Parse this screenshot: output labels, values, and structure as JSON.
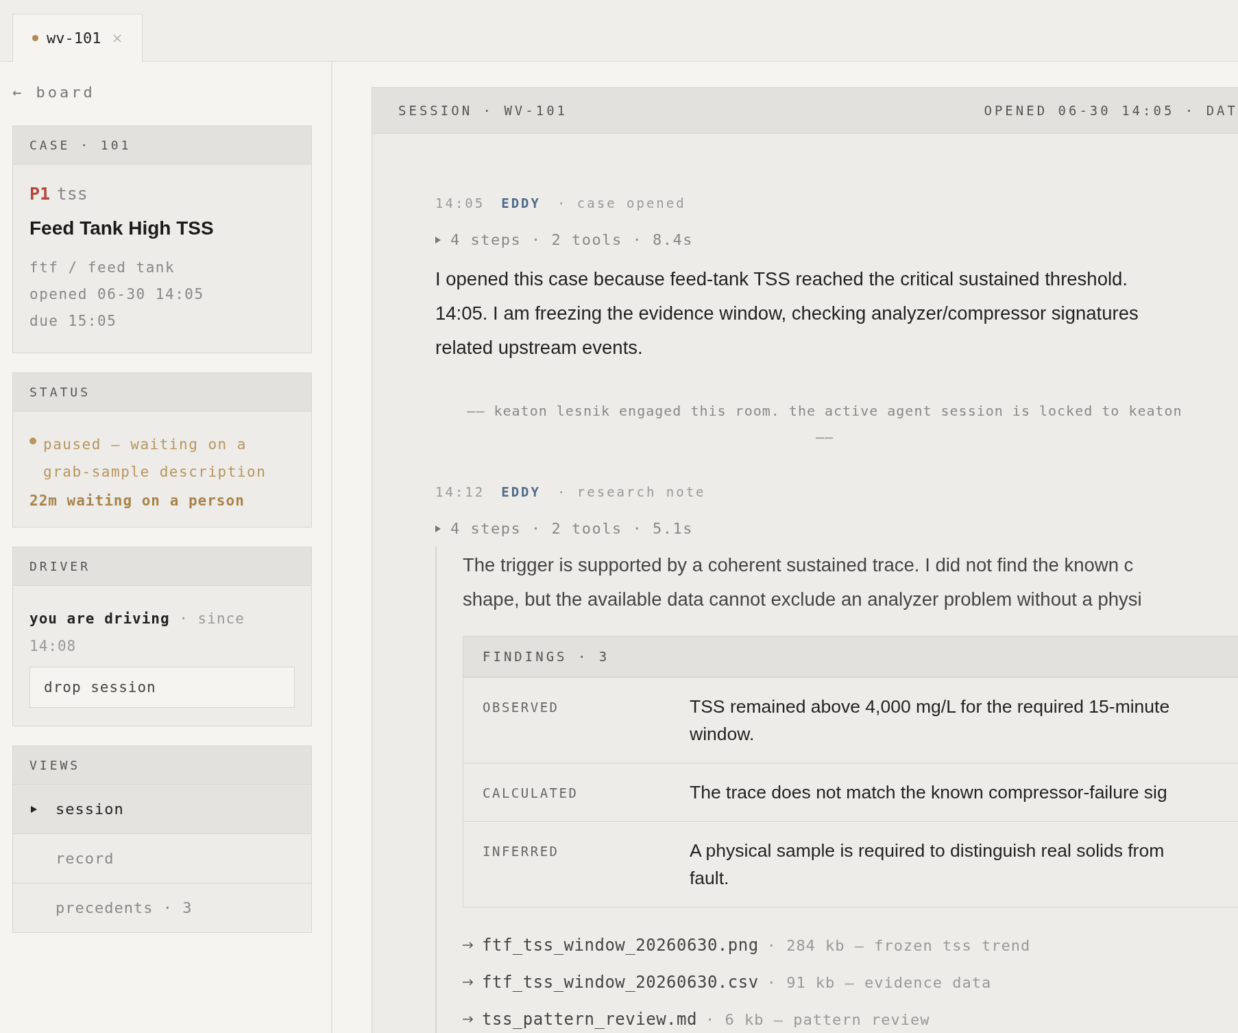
{
  "tabs": [
    {
      "label": "wv-101",
      "selected": true
    }
  ],
  "back_link": "← board",
  "case": {
    "header": "CASE · 101",
    "priority": "P1",
    "category": "tss",
    "title": "Feed Tank High TSS",
    "location": "ftf / feed tank",
    "opened": "opened 06-30 14:05",
    "due": "due 15:05"
  },
  "status": {
    "header": "STATUS",
    "state": "paused — waiting on a grab-sample description",
    "waiting": "22m waiting on a person"
  },
  "driver": {
    "header": "DRIVER",
    "driving": "you are driving",
    "since": "· since 14:08",
    "button": "drop session"
  },
  "views": {
    "header": "VIEWS",
    "items": [
      {
        "label": "session",
        "selected": true
      },
      {
        "label": "record",
        "selected": false
      },
      {
        "label": "precedents · 3",
        "selected": false
      }
    ]
  },
  "session": {
    "header_left": "SESSION · WV-101",
    "header_right": "OPENED 06-30 14:05 · DAT",
    "entries": [
      {
        "kind": "message",
        "time": "14:05",
        "author": "EDDY",
        "event": "· case opened",
        "steps": "4 steps · 2 tools · 8.4s",
        "expanded": false,
        "text_lines": [
          "I opened this case because feed-tank TSS reached the critical sustained threshold.",
          "14:05. I am freezing the evidence window, checking analyzer/compressor signatures",
          "related upstream events."
        ]
      },
      {
        "kind": "system",
        "text_lines": [
          "—— keaton lesnik engaged this room. the active agent session is locked to keaton",
          "——"
        ]
      },
      {
        "kind": "note",
        "time": "14:12",
        "author": "EDDY",
        "event": "· research note",
        "steps": "4 steps · 2 tools · 5.1s",
        "expanded": false,
        "text_lines": [
          "The trigger is supported by a coherent sustained trace. I did not find the known c",
          "shape, but the available data cannot exclude an analyzer problem without a physi"
        ],
        "findings": {
          "header": "FINDINGS · 3",
          "rows": [
            {
              "label": "OBSERVED",
              "text_lines": [
                "TSS remained above 4,000 mg/L for the required 15-minute",
                "window."
              ]
            },
            {
              "label": "CALCULATED",
              "text_lines": [
                "The trace does not match the known compressor-failure sig"
              ]
            },
            {
              "label": "INFERRED",
              "text_lines": [
                "A physical sample is required to distinguish real solids from",
                "fault."
              ]
            }
          ]
        },
        "files": [
          {
            "name": "ftf_tss_window_20260630.png",
            "detail": "· 284 kb — frozen tss trend"
          },
          {
            "name": "ftf_tss_window_20260630.csv",
            "detail": "· 91 kb — evidence data"
          },
          {
            "name": "tss_pattern_review.md",
            "detail": "· 6 kb — pattern review"
          }
        ]
      }
    ]
  }
}
